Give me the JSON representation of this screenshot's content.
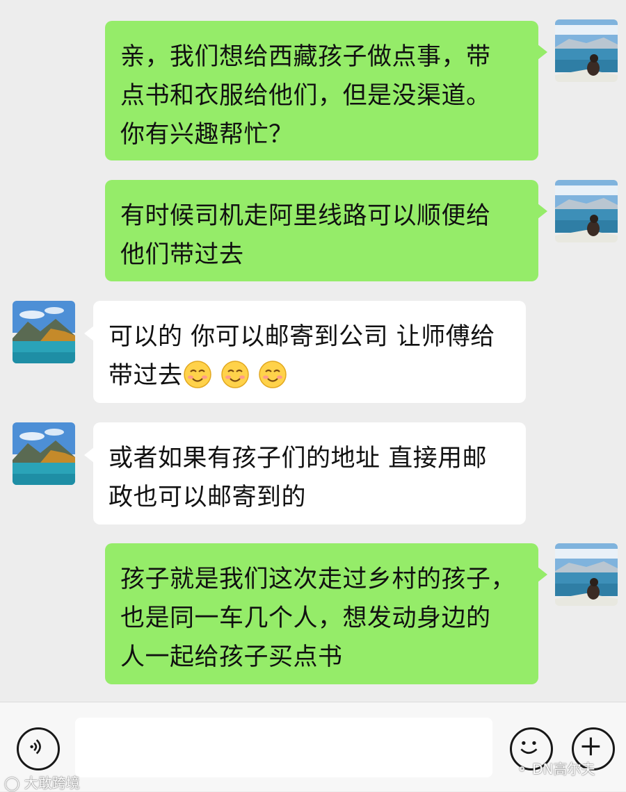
{
  "messages": [
    {
      "side": "me",
      "lines": [
        "亲，我们想给西藏孩子做点事，带",
        "点书和衣服给他们，但是没渠道。",
        "你有兴趣帮忙？"
      ]
    },
    {
      "side": "me",
      "lines": [
        "有时候司机走阿里线路可以顺便给",
        "他们带过去"
      ]
    },
    {
      "side": "them",
      "lines": [
        "可以的 你可以邮寄到公司 让师傅给",
        "带过去"
      ],
      "emoji": [
        "smile-emoji",
        "smile-emoji",
        "smile-emoji"
      ]
    },
    {
      "side": "them",
      "lines": [
        "或者如果有孩子们的地址 直接用邮",
        "政也可以邮寄到的"
      ]
    },
    {
      "side": "me",
      "lines": [
        "孩子就是我们这次走过乡村的孩子，",
        "也是同一车几个人，想发动身边的",
        "人一起给孩子买点书"
      ]
    }
  ],
  "input_bar": {
    "text_value": "",
    "voice_icon": "voice-icon",
    "emoji_icon": "emoji-icon",
    "plus_icon": "plus-icon"
  },
  "watermarks": {
    "left": "大敢跨境",
    "right": "DN高尔夫"
  },
  "colors": {
    "chat_background": "#ededed",
    "my_bubble": "#95ec69",
    "their_bubble": "#ffffff"
  }
}
